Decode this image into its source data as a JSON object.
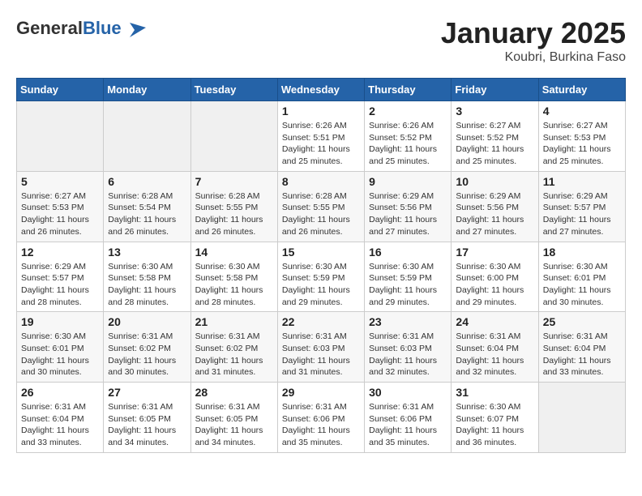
{
  "logo": {
    "general": "General",
    "blue": "Blue"
  },
  "title": "January 2025",
  "location": "Koubri, Burkina Faso",
  "days_header": [
    "Sunday",
    "Monday",
    "Tuesday",
    "Wednesday",
    "Thursday",
    "Friday",
    "Saturday"
  ],
  "weeks": [
    [
      {
        "day": "",
        "info": ""
      },
      {
        "day": "",
        "info": ""
      },
      {
        "day": "",
        "info": ""
      },
      {
        "day": "1",
        "info": "Sunrise: 6:26 AM\nSunset: 5:51 PM\nDaylight: 11 hours and 25 minutes."
      },
      {
        "day": "2",
        "info": "Sunrise: 6:26 AM\nSunset: 5:52 PM\nDaylight: 11 hours and 25 minutes."
      },
      {
        "day": "3",
        "info": "Sunrise: 6:27 AM\nSunset: 5:52 PM\nDaylight: 11 hours and 25 minutes."
      },
      {
        "day": "4",
        "info": "Sunrise: 6:27 AM\nSunset: 5:53 PM\nDaylight: 11 hours and 25 minutes."
      }
    ],
    [
      {
        "day": "5",
        "info": "Sunrise: 6:27 AM\nSunset: 5:53 PM\nDaylight: 11 hours and 26 minutes."
      },
      {
        "day": "6",
        "info": "Sunrise: 6:28 AM\nSunset: 5:54 PM\nDaylight: 11 hours and 26 minutes."
      },
      {
        "day": "7",
        "info": "Sunrise: 6:28 AM\nSunset: 5:55 PM\nDaylight: 11 hours and 26 minutes."
      },
      {
        "day": "8",
        "info": "Sunrise: 6:28 AM\nSunset: 5:55 PM\nDaylight: 11 hours and 26 minutes."
      },
      {
        "day": "9",
        "info": "Sunrise: 6:29 AM\nSunset: 5:56 PM\nDaylight: 11 hours and 27 minutes."
      },
      {
        "day": "10",
        "info": "Sunrise: 6:29 AM\nSunset: 5:56 PM\nDaylight: 11 hours and 27 minutes."
      },
      {
        "day": "11",
        "info": "Sunrise: 6:29 AM\nSunset: 5:57 PM\nDaylight: 11 hours and 27 minutes."
      }
    ],
    [
      {
        "day": "12",
        "info": "Sunrise: 6:29 AM\nSunset: 5:57 PM\nDaylight: 11 hours and 28 minutes."
      },
      {
        "day": "13",
        "info": "Sunrise: 6:30 AM\nSunset: 5:58 PM\nDaylight: 11 hours and 28 minutes."
      },
      {
        "day": "14",
        "info": "Sunrise: 6:30 AM\nSunset: 5:58 PM\nDaylight: 11 hours and 28 minutes."
      },
      {
        "day": "15",
        "info": "Sunrise: 6:30 AM\nSunset: 5:59 PM\nDaylight: 11 hours and 29 minutes."
      },
      {
        "day": "16",
        "info": "Sunrise: 6:30 AM\nSunset: 5:59 PM\nDaylight: 11 hours and 29 minutes."
      },
      {
        "day": "17",
        "info": "Sunrise: 6:30 AM\nSunset: 6:00 PM\nDaylight: 11 hours and 29 minutes."
      },
      {
        "day": "18",
        "info": "Sunrise: 6:30 AM\nSunset: 6:01 PM\nDaylight: 11 hours and 30 minutes."
      }
    ],
    [
      {
        "day": "19",
        "info": "Sunrise: 6:30 AM\nSunset: 6:01 PM\nDaylight: 11 hours and 30 minutes."
      },
      {
        "day": "20",
        "info": "Sunrise: 6:31 AM\nSunset: 6:02 PM\nDaylight: 11 hours and 30 minutes."
      },
      {
        "day": "21",
        "info": "Sunrise: 6:31 AM\nSunset: 6:02 PM\nDaylight: 11 hours and 31 minutes."
      },
      {
        "day": "22",
        "info": "Sunrise: 6:31 AM\nSunset: 6:03 PM\nDaylight: 11 hours and 31 minutes."
      },
      {
        "day": "23",
        "info": "Sunrise: 6:31 AM\nSunset: 6:03 PM\nDaylight: 11 hours and 32 minutes."
      },
      {
        "day": "24",
        "info": "Sunrise: 6:31 AM\nSunset: 6:04 PM\nDaylight: 11 hours and 32 minutes."
      },
      {
        "day": "25",
        "info": "Sunrise: 6:31 AM\nSunset: 6:04 PM\nDaylight: 11 hours and 33 minutes."
      }
    ],
    [
      {
        "day": "26",
        "info": "Sunrise: 6:31 AM\nSunset: 6:04 PM\nDaylight: 11 hours and 33 minutes."
      },
      {
        "day": "27",
        "info": "Sunrise: 6:31 AM\nSunset: 6:05 PM\nDaylight: 11 hours and 34 minutes."
      },
      {
        "day": "28",
        "info": "Sunrise: 6:31 AM\nSunset: 6:05 PM\nDaylight: 11 hours and 34 minutes."
      },
      {
        "day": "29",
        "info": "Sunrise: 6:31 AM\nSunset: 6:06 PM\nDaylight: 11 hours and 35 minutes."
      },
      {
        "day": "30",
        "info": "Sunrise: 6:31 AM\nSunset: 6:06 PM\nDaylight: 11 hours and 35 minutes."
      },
      {
        "day": "31",
        "info": "Sunrise: 6:30 AM\nSunset: 6:07 PM\nDaylight: 11 hours and 36 minutes."
      },
      {
        "day": "",
        "info": ""
      }
    ]
  ]
}
